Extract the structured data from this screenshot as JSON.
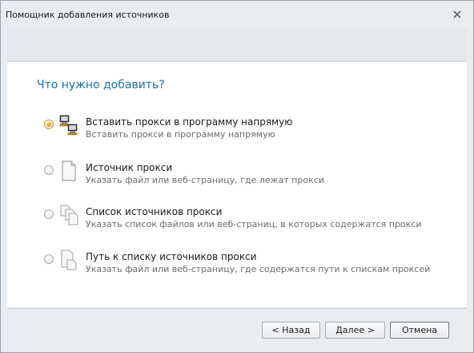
{
  "window": {
    "title": "Помощник добавления источников"
  },
  "content": {
    "heading": "Что нужно добавить?",
    "options": [
      {
        "title": "Вставить прокси в программу напрямую",
        "description": "Вставить прокси в программу напрямую",
        "icon": "computers-icon",
        "selected": true
      },
      {
        "title": "Источник прокси",
        "description": "Указать файл или веб-страницу, где лежат прокси",
        "icon": "document-icon",
        "selected": false
      },
      {
        "title": "Список источников прокси",
        "description": "Указать список файлов или веб-страниц, в которых содержатся прокси",
        "icon": "documents-stack-icon",
        "selected": false
      },
      {
        "title": "Путь к списку источников прокси",
        "description": "Указать файл или веб-страницу, где содержатся пути к спискам проксей",
        "icon": "document-stack-path-icon",
        "selected": false
      }
    ]
  },
  "footer": {
    "back_label": "< Назад",
    "next_label": "Далее >",
    "cancel_label": "Отмена"
  },
  "colors": {
    "heading": "#1e6fae",
    "radio_selected": "#f39b12",
    "window_bg": "#e9ecf0"
  }
}
